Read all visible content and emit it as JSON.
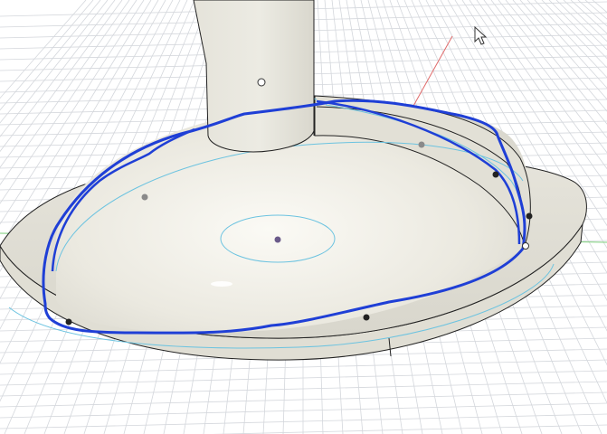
{
  "viewport": {
    "background": "#ffffff",
    "grid_color": "#d4d7dc",
    "axis_x_color": "#e06a6a",
    "axis_z_color": "#7ccf7a"
  },
  "model": {
    "body_color": "#ebe9e0",
    "shadow_color": "#d8d6cc",
    "edge_color": "#222222",
    "construction_color": "#6cc3e0",
    "sketch_stroke_color": "#1f3fd6"
  },
  "cursor": {
    "icon": "arrow-cursor-icon"
  }
}
